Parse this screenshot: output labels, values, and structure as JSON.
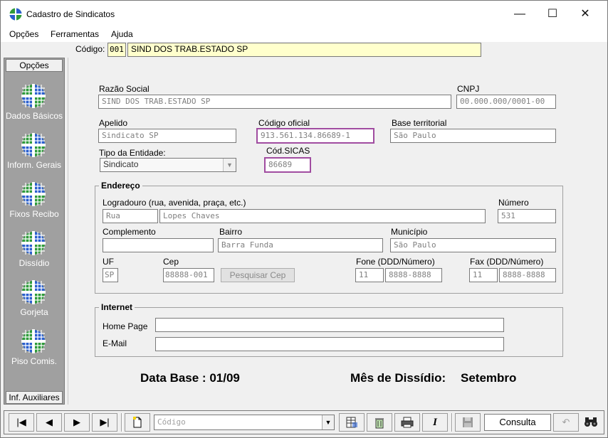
{
  "window": {
    "title": "Cadastro de Sindicatos",
    "minimize": "—",
    "maximize": "☐",
    "close": "✕"
  },
  "menu": {
    "items": [
      "Opções",
      "Ferramentas",
      "Ajuda"
    ]
  },
  "header": {
    "codigo_label": "Código:",
    "codigo_value": "001",
    "nome_value": "SIND DOS TRAB.ESTADO SP"
  },
  "sidebar": {
    "header": "Opções",
    "items": [
      "Dados Básicos",
      "Inform. Gerais",
      "Fixos Recibo",
      "Dissídio",
      "Gorjeta",
      "Piso Comis."
    ],
    "footer": "Inf. Auxiliares",
    "icon_colors": {
      "green": "#2e9b3a",
      "blue": "#2a5fcf",
      "white": "#ffffff"
    }
  },
  "form": {
    "razao_social_label": "Razão Social",
    "razao_social_value": "SIND DOS TRAB.ESTADO SP",
    "cnpj_label": "CNPJ",
    "cnpj_value": "00.000.000/0001-00",
    "apelido_label": "Apelido",
    "apelido_value": "Sindicato SP",
    "codigo_oficial_label": "Código oficial",
    "codigo_oficial_value": "913.561.134.86689-1",
    "base_territorial_label": "Base territorial",
    "base_territorial_value": "São Paulo",
    "tipo_entidade_label": "Tipo da Entidade:",
    "tipo_entidade_value": "Sindicato",
    "cod_sicas_label": "Cód.SICAS",
    "cod_sicas_value": "86689"
  },
  "endereco": {
    "title": "Endereço",
    "logradouro_label": "Logradouro (rua, avenida, praça, etc.)",
    "logradouro_tipo": "Rua",
    "logradouro_value": "Lopes Chaves",
    "numero_label": "Número",
    "numero_value": "531",
    "complemento_label": "Complemento",
    "complemento_value": "",
    "bairro_label": "Bairro",
    "bairro_value": "Barra Funda",
    "municipio_label": "Município",
    "municipio_value": "São Paulo",
    "uf_label": "UF",
    "uf_value": "SP",
    "cep_label": "Cep",
    "cep_value": "88888-001",
    "pesquisar_cep": "Pesquisar Cep",
    "fone_label": "Fone (DDD/Número)",
    "fone_ddd": "11",
    "fone_numero": "8888-8888",
    "fax_label": "Fax (DDD/Número)",
    "fax_ddd": "11",
    "fax_numero": "8888-8888"
  },
  "internet": {
    "title": "Internet",
    "homepage_label": "Home Page",
    "homepage_value": "",
    "email_label": "E-Mail",
    "email_value": ""
  },
  "footer_info": {
    "data_base": "Data Base : 01/09",
    "mes_dissidio_label": "Mês de Dissídio:",
    "mes_dissidio_value": "Setembro"
  },
  "toolbar": {
    "first": "|◀",
    "prev": "◀",
    "next": "▶",
    "last": "▶|",
    "search_placeholder": "Código",
    "mode": "Consulta"
  },
  "colors": {
    "highlight": "#a04ca0",
    "yellow_field": "#ffffcc",
    "sidebar_bg": "#a0a0a0"
  }
}
